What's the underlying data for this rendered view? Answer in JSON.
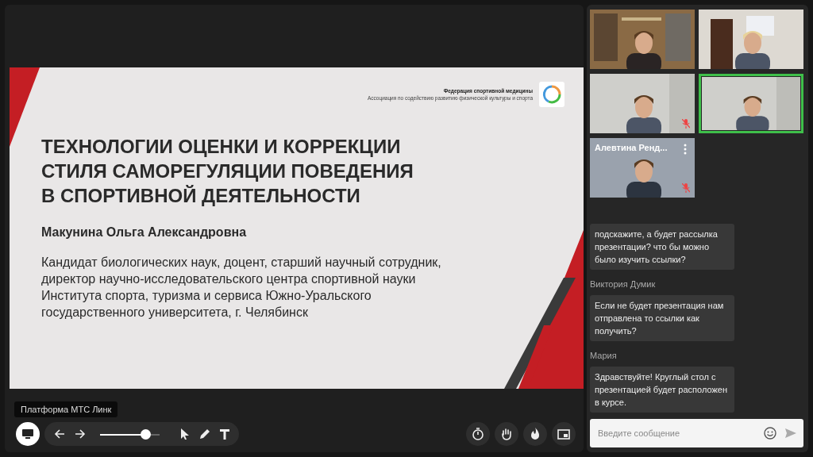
{
  "slide": {
    "org_title": "Федерация спортивной медицины",
    "org_subtitle": "Ассоциация по содействию развитию физической культуры и спорта",
    "title_lines": [
      "ТЕХНОЛОГИИ ОЦЕНКИ И КОРРЕКЦИИ",
      "СТИЛЯ САМОРЕГУЛЯЦИИ ПОВЕДЕНИЯ",
      "В СПОРТИВНОЙ ДЕЯТЕЛЬНОСТИ"
    ],
    "author": "Макунина Ольга Александровна",
    "bio": "Кандидат биологических наук, доцент, старший научный сотрудник, директор научно-исследовательского центра спортивной науки Института спорта, туризма и сервиса Южно-Уральского государственного университета, г. Челябинск"
  },
  "platform_label": "Платформа МТС Линк",
  "toolbar": {
    "screen_selected": true,
    "zoom": {
      "level": 0.76
    }
  },
  "videos": [
    {
      "speaking": false,
      "muted": false
    },
    {
      "speaking": false,
      "muted": false
    },
    {
      "speaking": false,
      "muted": true
    },
    {
      "speaking": true,
      "muted": false
    },
    {
      "speaking": false,
      "muted": true,
      "name": "Алевтина Ренд..."
    }
  ],
  "chat": {
    "messages": [
      {
        "text": "подскажите, а будет рассылка презентации? что бы можно было изучить ссылки?"
      },
      {
        "author": "Виктория Думик",
        "text": "Если не будет презентация нам отправлена то ссылки как получить?"
      },
      {
        "author": "Мария",
        "text": "Здравствуйте! Круглый стол с презентацией будет расположен в курсе."
      }
    ],
    "placeholder": "Введите сообщение"
  }
}
